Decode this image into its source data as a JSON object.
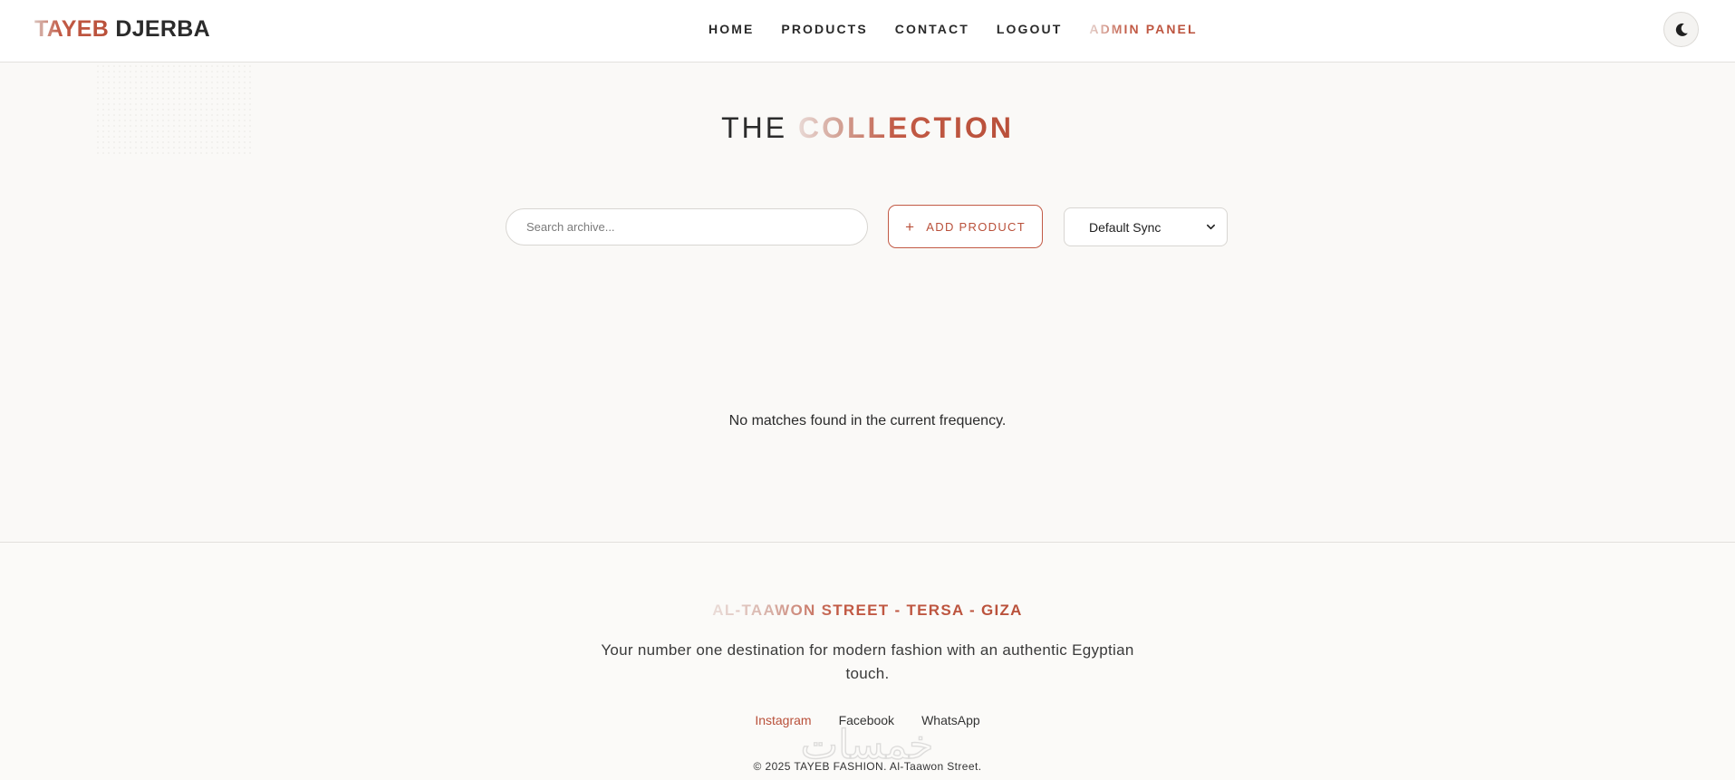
{
  "header": {
    "brand_part1": "TAYEB",
    "brand_part2": "DJERBA",
    "nav": [
      "HOME",
      "PRODUCTS",
      "CONTACT",
      "LOGOUT",
      "ADMIN PANEL"
    ],
    "theme_toggle_icon": "moon-icon"
  },
  "main": {
    "title_plain": "THE",
    "title_accent": "COLLECTION",
    "search_placeholder": "Search archive...",
    "add_button_icon": "plus-icon",
    "add_button_label": "ADD PRODUCT",
    "sort_select_value": "Default Sync",
    "empty_message": "No matches found in the current frequency."
  },
  "footer": {
    "address": "AL-TAAWON STREET - TERSA - GIZA",
    "tagline": "Your number one destination for modern fashion with an authentic Egyptian touch.",
    "social_links": [
      "Instagram",
      "Facebook",
      "WhatsApp"
    ],
    "copyright": "© 2025 TAYEB FASHION. Al-Taawon Street.",
    "watermark_text": "خمسات"
  },
  "colors": {
    "accent": "#b9503a",
    "background": "#faf9f7"
  }
}
